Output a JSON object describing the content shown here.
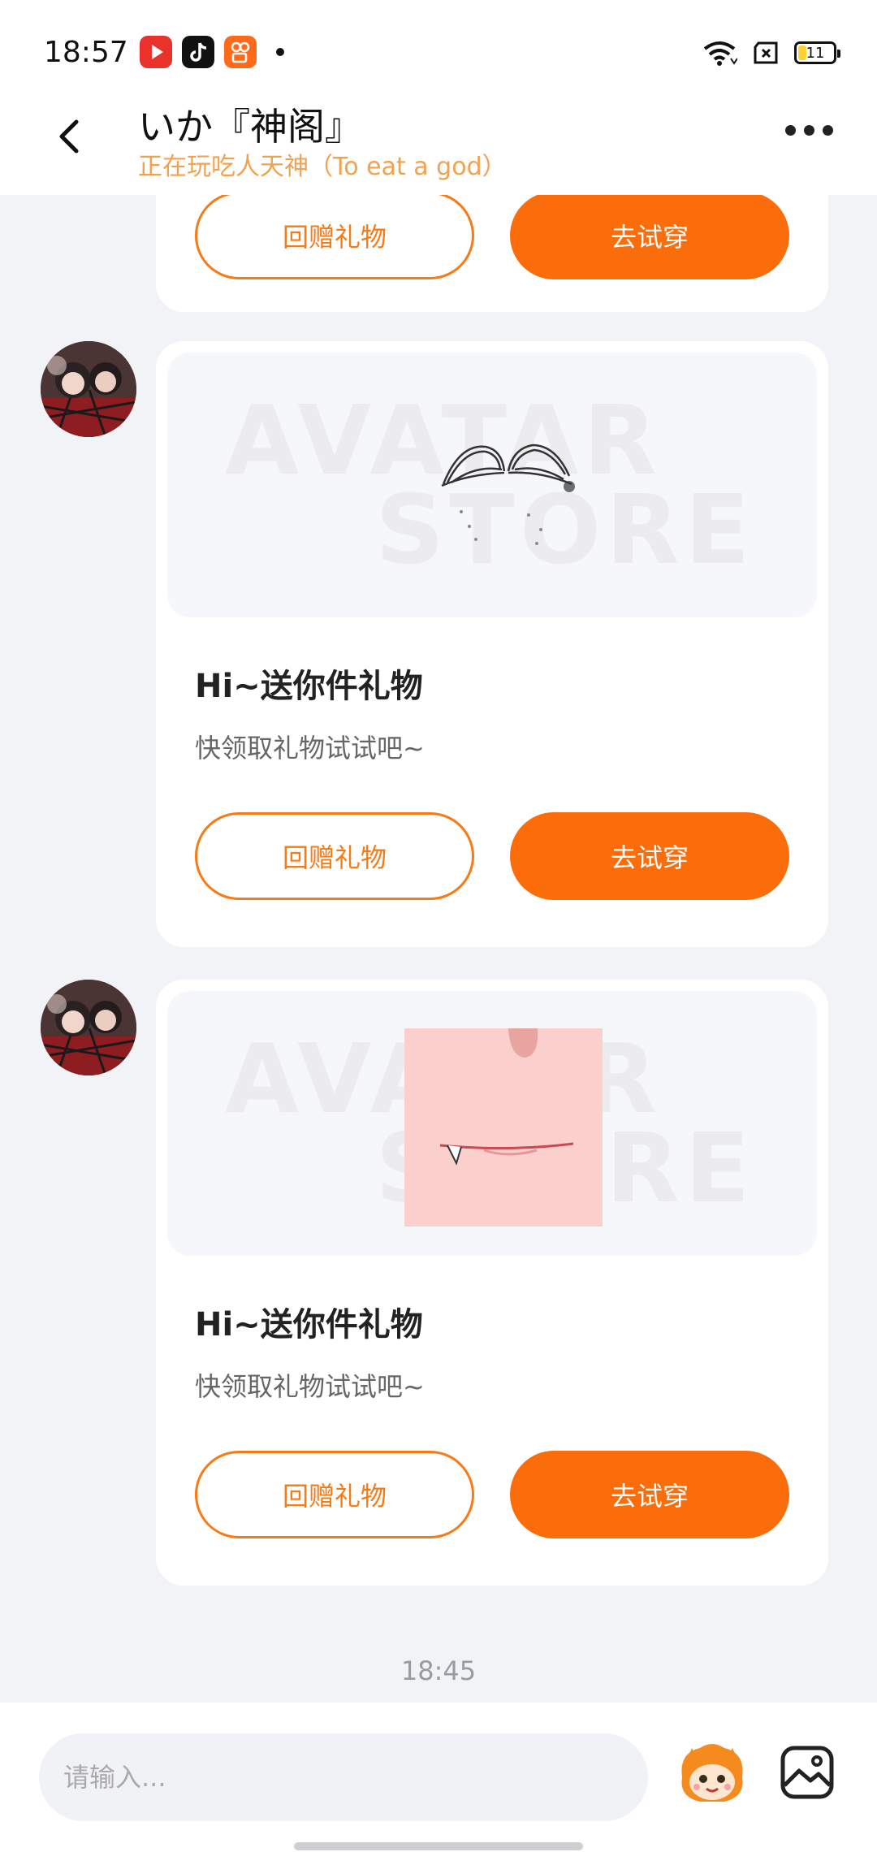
{
  "status_bar": {
    "time": "18:57",
    "battery": "11",
    "icons": [
      "video-app-icon",
      "tiktok-icon",
      "kuaishou-icon",
      "wifi-icon",
      "sim-icon",
      "battery-icon"
    ]
  },
  "header": {
    "title": "いか『神阁』",
    "subtitle": "正在玩吃人天神（To eat a god）"
  },
  "messages": [
    {
      "return_gift_label": "回赠礼物",
      "try_on_label": "去试穿"
    },
    {
      "watermark_line1": "AVATAR",
      "watermark_line2": "STORE",
      "title": "Hi~送你件礼物",
      "desc": "快领取礼物试试吧~",
      "return_gift_label": "回赠礼物",
      "try_on_label": "去试穿"
    },
    {
      "watermark_line1": "AVATAR",
      "watermark_line2": "STORE",
      "title": "Hi~送你件礼物",
      "desc": "快领取礼物试试吧~",
      "return_gift_label": "回赠礼物",
      "try_on_label": "去试穿"
    }
  ],
  "timestamp": "18:45",
  "input": {
    "placeholder": "请输入..."
  },
  "colors": {
    "accent": "#fb6d0a",
    "subtitle": "#f2a24f",
    "background": "#f2f3f7"
  }
}
